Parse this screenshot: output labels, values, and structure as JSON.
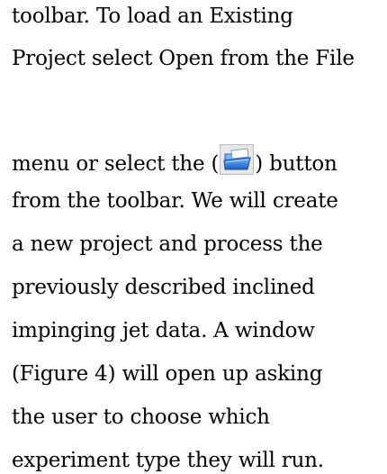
{
  "document": {
    "lines": [
      "toolbar.  To load an Existing",
      "Project select Open from the File",
      "",
      "from the toolbar.  We will create",
      "a new project and process the",
      "previously described inclined",
      "impinging jet data.  A window",
      "(Figure 4) will open up asking",
      "the user to choose which",
      "experiment type they will run."
    ],
    "line3": {
      "before": "menu or select the (",
      "icon": "open-folder-icon",
      "after": ") button"
    }
  }
}
